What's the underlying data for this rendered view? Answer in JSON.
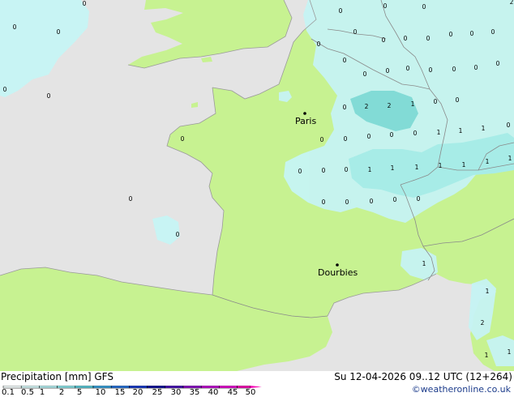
{
  "map": {
    "colors": {
      "sea": "#e4e4e4",
      "land": "#c7f291",
      "border": "#8a8a8a",
      "coast": "#9a9a9a",
      "precip_light": "#c6f4f4",
      "precip_mid": "#a6ecec",
      "precip_heavy": "#7fdada"
    },
    "cities": [
      {
        "name": "Paris"
      },
      {
        "name": "Dourbies"
      }
    ],
    "value_labels": [
      "0",
      "0",
      "0",
      "0",
      "0",
      "0",
      "0",
      "0",
      "0",
      "0",
      "0",
      "0",
      "0",
      "0",
      "0",
      "0",
      "0",
      "0",
      "0",
      "0",
      "0",
      "0",
      "0",
      "0",
      "0",
      "0",
      "0",
      "0",
      "0",
      "0",
      "0",
      "0",
      "0",
      "0",
      "0",
      "0",
      "0",
      "0",
      "0",
      "0",
      "0",
      "0",
      "2",
      "2",
      "1",
      "1",
      "1",
      "1",
      "1",
      "1",
      "1",
      "1",
      "1",
      "1",
      "1",
      "1",
      "1",
      "2",
      "1",
      "1",
      "2",
      "0",
      "0"
    ]
  },
  "footer": {
    "title": "Precipitation [mm] GFS",
    "datetime": "Su 12-04-2026 09..12 UTC (12+264)",
    "credit": "©weatheronline.co.uk"
  },
  "legend": {
    "ticks": [
      "0.1",
      "0.5",
      "1",
      "2",
      "5",
      "10",
      "15",
      "20",
      "25",
      "30",
      "35",
      "40",
      "45",
      "50"
    ],
    "colors": [
      "#f6fefe",
      "#d8f8f8",
      "#b6eef0",
      "#8ee2e6",
      "#5ec8d6",
      "#3aa0d8",
      "#2a72d6",
      "#1c3ec8",
      "#10149c",
      "#4a14b4",
      "#8c12c4",
      "#c010d0",
      "#e40cd0",
      "#f40ab4"
    ]
  }
}
